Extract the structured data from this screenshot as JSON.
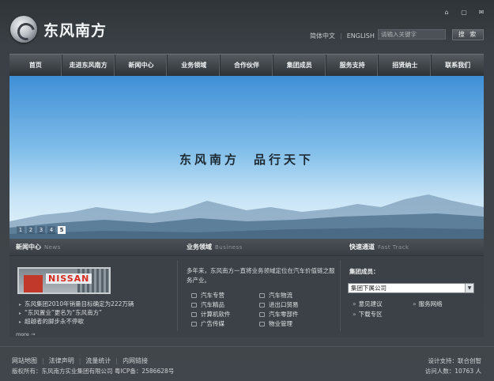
{
  "header": {
    "logo_text": "东风南方",
    "icons": [
      "home-icon",
      "document-icon",
      "mail-icon"
    ],
    "lang_zh": "简体中文",
    "lang_en": "ENGLISH",
    "search_placeholder": "请输入关键字",
    "search_button": "搜 索"
  },
  "nav": {
    "items": [
      "首页",
      "走进东风南方",
      "新闻中心",
      "业务领域",
      "合作伙伴",
      "集团成员",
      "服务支持",
      "招贤纳士",
      "联系我们"
    ]
  },
  "banner": {
    "slogan_left": "东风南方",
    "slogan_right": "品行天下",
    "pages": [
      "1",
      "2",
      "3",
      "4",
      "5"
    ],
    "active_page": "5"
  },
  "news": {
    "title": "新闻中心",
    "title_en": "News",
    "image_brand": "NISSAN",
    "items": [
      "东风集团2010年销量目标确定为222万辆",
      "“东风置业”更名为“东风南方”",
      "超越者的脚步永不停歇"
    ],
    "more": "more"
  },
  "business": {
    "title": "业务领域",
    "title_en": "Business",
    "description": "多年来，东风南方一直将业务领域定位在汽车价值链之服务产业。",
    "items": [
      "汽车专营",
      "汽车物流",
      "汽车精品",
      "进出口贸易",
      "计算机软件",
      "汽车零部件",
      "广告传媒",
      "物业管理"
    ]
  },
  "quick": {
    "title": "快速通道",
    "title_en": "Fast Track",
    "member_label": "集团成员：",
    "select_value": "集团下属公司",
    "links": [
      "意见建议",
      "服务网络",
      "下载专区"
    ]
  },
  "footer": {
    "links": [
      "网站地图",
      "法律声明",
      "流量统计",
      "内网链接"
    ],
    "copyright": "版权所有：东风南方实业集团有限公司  粤ICP备：2586628号",
    "design": "设计支持：联合创智",
    "visits": "访问人数：10763 人"
  },
  "colors": {
    "background": "#3e4448",
    "nav": "#3a4045",
    "banner_sky": "#7fbde9"
  }
}
